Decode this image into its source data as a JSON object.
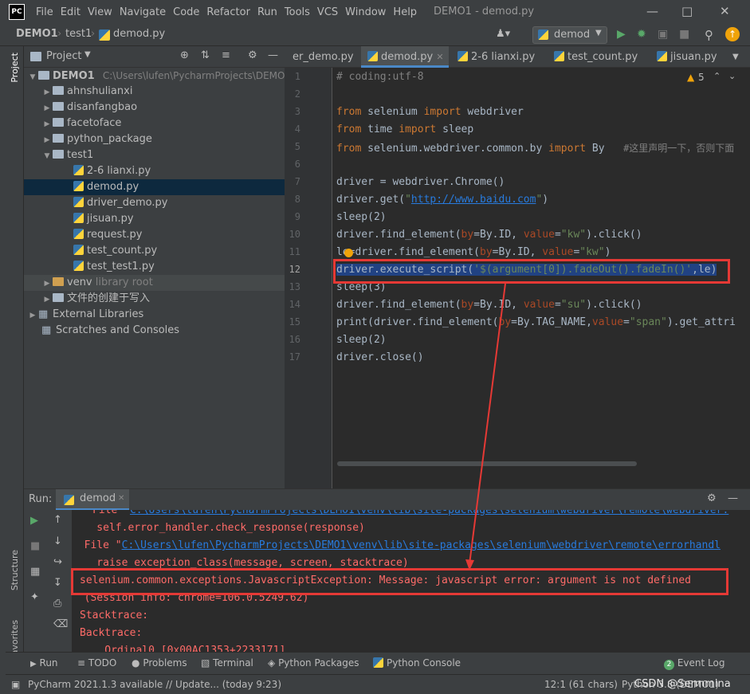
{
  "menubar": {
    "logo": "PC",
    "items": [
      "File",
      "Edit",
      "View",
      "Navigate",
      "Code",
      "Refactor",
      "Run",
      "Tools",
      "VCS",
      "Window",
      "Help"
    ],
    "window_title": "DEMO1 - demod.py"
  },
  "navbar": {
    "crumbs": [
      "DEMO1",
      "test1",
      "demod.py"
    ],
    "run_config": "demod"
  },
  "sidestrip": {
    "project_label": "Project",
    "structure_label": "Structure",
    "favorites_label": "Favorites"
  },
  "project": {
    "header": "Project",
    "root_name": "DEMO1",
    "root_path": "C:\\Users\\lufen\\PycharmProjects\\DEMO1",
    "folders": [
      "ahnshulianxi",
      "disanfangbao",
      "facetoface",
      "python_package"
    ],
    "test1": "test1",
    "files": [
      "2-6 lianxi.py",
      "demod.py",
      "driver_demo.py",
      "jisuan.py",
      "request.py",
      "test_count.py",
      "test_test1.py"
    ],
    "venv": "venv",
    "venv_note": "library root",
    "write_folder": "文件的创建于写入",
    "external": "External Libraries",
    "scratches": "Scratches and Consoles"
  },
  "tabs": [
    "er_demo.py",
    "demod.py",
    "2-6 lianxi.py",
    "test_count.py",
    "jisuan.py"
  ],
  "editor": {
    "inspection_count": "5",
    "line_numbers": [
      "1",
      "2",
      "3",
      "4",
      "5",
      "6",
      "7",
      "8",
      "9",
      "10",
      "11",
      "12",
      "13",
      "14",
      "15",
      "16",
      "17"
    ],
    "l1": "# coding:utf-8",
    "l3a": "from",
    "l3b": " selenium ",
    "l3c": "import",
    "l3d": " webdriver",
    "l4a": "from",
    "l4b": " time ",
    "l4c": "import",
    "l4d": " sleep",
    "l5a": "from",
    "l5b": " selenium.webdriver.common.by ",
    "l5c": "import",
    "l5d": " By   ",
    "l5e": "#这里声明一下，否则下面",
    "l7": "driver = webdriver.Chrome()",
    "l8a": "driver.get(",
    "l8b": "\"",
    "l8c": "http://www.baidu.com",
    "l8d": "\"",
    "l8e": ")",
    "l9": "sleep(2)",
    "l10a": "driver.find_element(",
    "l10b": "by",
    "l10c": "=By.ID, ",
    "l10d": "value",
    "l10e": "=",
    "l10f": "\"kw\"",
    "l10g": ").click()",
    "l11a": "le=driver.find_element(",
    "l11b": "by",
    "l11c": "=By.ID, ",
    "l11d": "value",
    "l11e": "=",
    "l11f": "\"kw\"",
    "l11g": ")",
    "l12a": "driver.execute_script(",
    "l12b": "'$(argument[0]).fadeOut().fadeIn()'",
    "l12c": ",le)",
    "l13": "sleep(3)",
    "l14a": "driver.find_element(",
    "l14b": "by",
    "l14c": "=By.ID, ",
    "l14d": "value",
    "l14e": "=",
    "l14f": "\"su\"",
    "l14g": ").click()",
    "l15a": "print(driver.find_element(",
    "l15b": "by",
    "l15c": "=By.TAG_NAME,",
    "l15d": "value",
    "l15e": "=",
    "l15f": "\"span\"",
    "l15g": ").get_attri",
    "l16": "sleep(2)",
    "l17": "driver.close()"
  },
  "run": {
    "label": "Run:",
    "tab": "demod",
    "c1a": "File \"",
    "c1b": "C:\\Users\\lufen\\PycharmProjects\\DEMO1\\venv\\lib\\site-packages\\selenium\\webdriver\\remote\\webdriver.",
    "c2": "    self.error_handler.check_response(response)",
    "c3a": "  File \"",
    "c3b": "C:\\Users\\lufen\\PycharmProjects\\DEMO1\\venv\\lib\\site-packages\\selenium\\webdriver\\remote\\errorhandl",
    "c4": "    raise exception_class(message, screen, stacktrace)",
    "c5": "selenium.common.exceptions.JavascriptException: Message: javascript error: argument is not defined",
    "c6": "  (Session info: chrome=106.0.5249.62)",
    "c7": "Stacktrace:",
    "c8": "Backtrace:",
    "c9": "    Ordinal0 [0x00AC1353+2233171]"
  },
  "toolstrip": {
    "run": "Run",
    "todo": "TODO",
    "problems": "Problems",
    "terminal": "Terminal",
    "packages": "Python Packages",
    "console": "Python Console",
    "event_log": "Event Log",
    "event_count": "2"
  },
  "status": {
    "left": "PyCharm 2021.1.3 available // Update... (today 9:23)",
    "pos": "12:1 (61 chars)",
    "interp": "Python 3.8 (DEMO1)",
    "watermark": "CSDN @Sermmina"
  },
  "colors": {
    "annotation": "#e53935",
    "selection": "#214283",
    "accent": "#4a88c7"
  }
}
